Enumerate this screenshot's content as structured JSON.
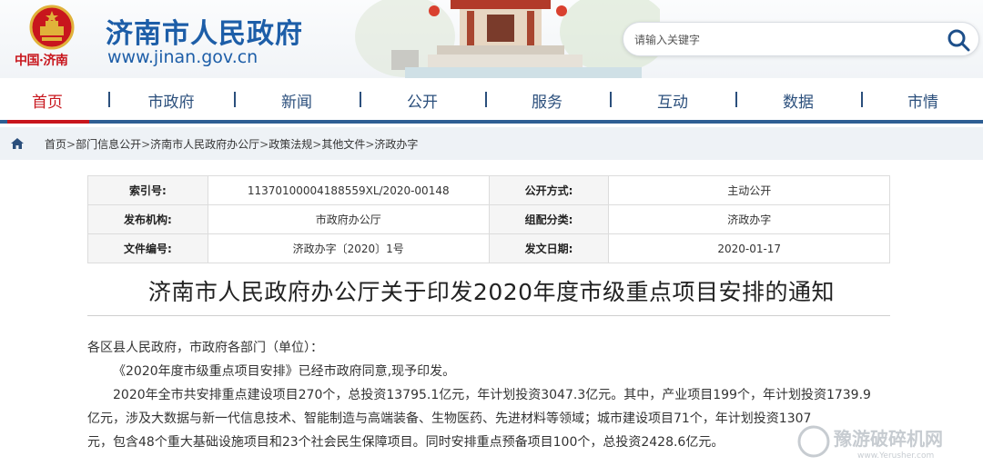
{
  "header": {
    "emblem_caption": "中国·济南",
    "site_title": "济南市人民政府",
    "site_url": "www.jinan.gov.cn",
    "search": {
      "placeholder": "请输入关键字",
      "icon": "search-icon"
    }
  },
  "nav": {
    "items": [
      {
        "label": "首页",
        "active": true
      },
      {
        "label": "市政府",
        "active": false
      },
      {
        "label": "新闻",
        "active": false
      },
      {
        "label": "公开",
        "active": false
      },
      {
        "label": "服务",
        "active": false
      },
      {
        "label": "互动",
        "active": false
      },
      {
        "label": "数据",
        "active": false
      },
      {
        "label": "市情",
        "active": false
      }
    ]
  },
  "breadcrumb": {
    "icon": "home-icon",
    "items": [
      "首页",
      "部门信息公开",
      "济南市人民政府办公厅",
      "政策法规",
      "其他文件",
      "济政办字"
    ],
    "separator": ">"
  },
  "meta": {
    "index_no_label": "索引号:",
    "index_no": "11370100004188559XL/2020-00148",
    "disclosure_label": "公开方式:",
    "disclosure": "主动公开",
    "publisher_label": "发布机构:",
    "publisher": "市政府办公厅",
    "category_label": "组配分类:",
    "category": "济政办字",
    "doc_no_label": "文件编号:",
    "doc_no": "济政办字〔2020〕1号",
    "date_label": "发文日期:",
    "date": "2020-01-17"
  },
  "article": {
    "title": "济南市人民政府办公厅关于印发2020年度市级重点项目安排的通知",
    "lines": [
      "各区县人民政府，市政府各部门（单位）：",
      "《2020年度市级重点项目安排》已经市政府同意,现予印发。",
      "2020年全市共安排重点建设项目270个，总投资13795.1亿元，年计划投资3047.3亿元。其中，产业项目199个，年计划投资1739.9",
      "亿元，涉及大数据与新一代信息技术、智能制造与高端装备、生物医药、先进材料等领域；城市建设项目71个，年计划投资1307",
      "元，包含48个重大基础设施项目和23个社会民生保障项目。同时安排重点预备项目100个，总投资2428.6亿元。"
    ]
  },
  "watermark": {
    "text": "豫游破碎机网",
    "url": "www.Yerusher.com"
  },
  "colors": {
    "brand_blue": "#1d5ea8",
    "nav_text": "#2b4f7c",
    "accent_red": "#c8161d",
    "breadcrumb_bg": "#eef2f6"
  }
}
